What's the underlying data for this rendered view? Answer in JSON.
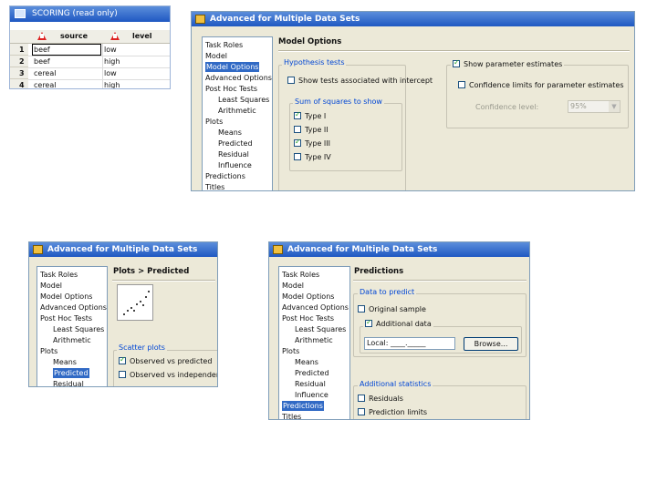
{
  "scoring": {
    "title": "SCORING (read only)",
    "columns": [
      "source",
      "level"
    ],
    "rows": [
      {
        "num": "1",
        "source": "beef",
        "level": "low"
      },
      {
        "num": "2",
        "source": "beef",
        "level": "high"
      },
      {
        "num": "3",
        "source": "cereal",
        "level": "low"
      },
      {
        "num": "4",
        "source": "cereal",
        "level": "high"
      }
    ]
  },
  "tree_items": {
    "task_roles": "Task Roles",
    "model": "Model",
    "model_options": "Model Options",
    "advanced_options": "Advanced Options",
    "post_hoc_tests": "Post Hoc Tests",
    "least_squares": "Least Squares",
    "arithmetic": "Arithmetic",
    "plots": "Plots",
    "means": "Means",
    "predicted": "Predicted",
    "residual": "Residual",
    "influence": "Influence",
    "predictions": "Predictions",
    "titles": "Titles"
  },
  "win1": {
    "title": "Advanced for Multiple Data Sets",
    "panel_title": "Model Options",
    "hyp_group": "Hypothesis tests",
    "show_intercept": "Show tests associated with intercept",
    "ss_group": "Sum of squares to show",
    "type1": "Type I",
    "type2": "Type II",
    "type3": "Type III",
    "type4": "Type IV",
    "show_param": "Show parameter estimates",
    "conf_limits": "Confidence limits for parameter estimates",
    "conf_level_label": "Confidence level:",
    "conf_level_value": "95%"
  },
  "win2": {
    "title": "Advanced for Multiple Data Sets",
    "panel_title": "Plots > Predicted",
    "scatter_group": "Scatter plots",
    "obs_vs_pred": "Observed vs predicted",
    "obs_vs_indep": "Observed vs independents"
  },
  "win3": {
    "title": "Advanced for Multiple Data Sets",
    "panel_title": "Predictions",
    "data_group": "Data to predict",
    "original_sample": "Original sample",
    "additional_data": "Additional data",
    "data_path": "Local: ____._____",
    "browse": "Browse...",
    "stats_group": "Additional statistics",
    "residuals": "Residuals",
    "prediction_limits": "Prediction limits"
  }
}
